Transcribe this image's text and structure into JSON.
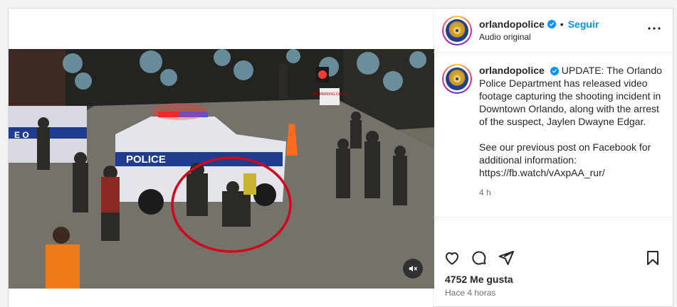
{
  "header": {
    "username": "orlandopolice",
    "separator": "•",
    "follow_label": "Seguir",
    "audio_label": "Audio original",
    "more_icon": "more-horizontal-icon"
  },
  "caption": {
    "username": "orlandopolice",
    "text": "UPDATE: The Orlando Police Department has released video footage capturing the shooting incident in Downtown Orlando, along with the arrest of the suspect, Jaylen Dwayne Edgar.",
    "text2": "See our previous post on Facebook for additional information: https://fb.watch/vAxpAA_rur/",
    "time": "4 h"
  },
  "video": {
    "vehicle_text": "POLICE",
    "side_text": "E O",
    "sign_text": "NO PARKING DAILY",
    "mute_icon": "muted-speaker-icon"
  },
  "actions": {
    "like_icon": "heart-icon",
    "comment_icon": "comment-icon",
    "share_icon": "paper-plane-icon",
    "save_icon": "bookmark-icon"
  },
  "stats": {
    "likes": "4752 Me gusta",
    "posted": "Hace 4 horas"
  },
  "colors": {
    "link_blue": "#0095f6",
    "annotation_red": "#d3061b"
  }
}
